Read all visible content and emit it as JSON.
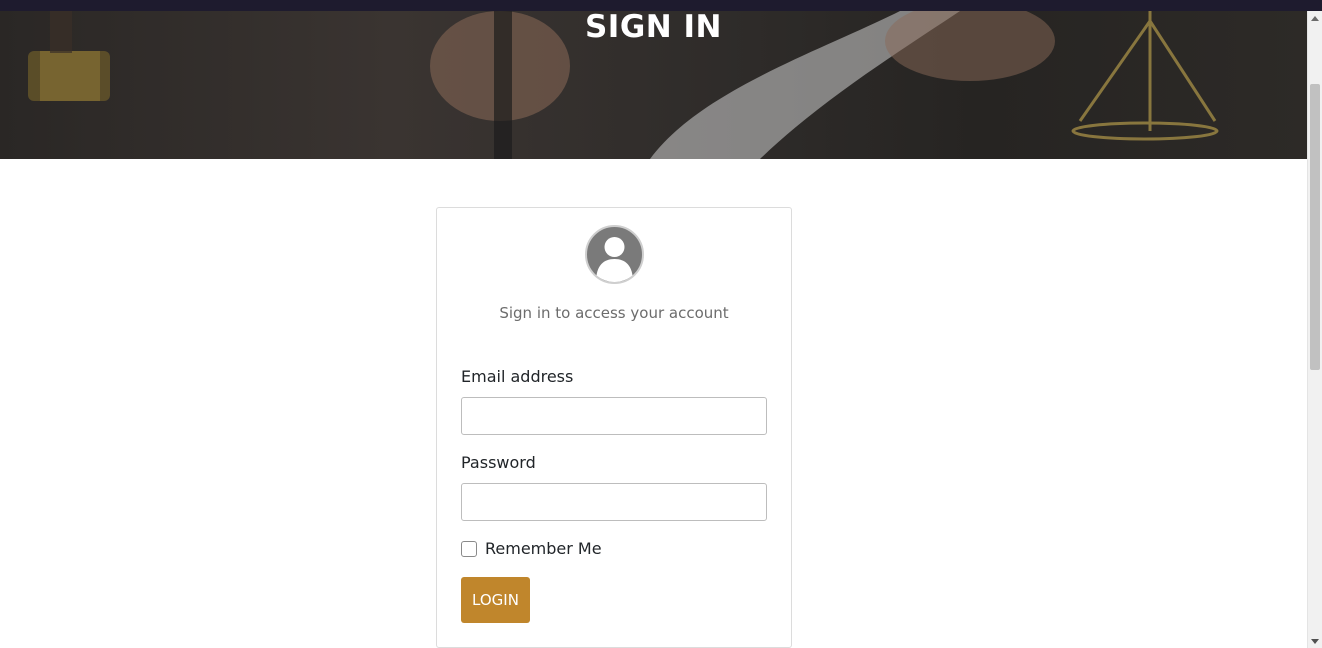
{
  "hero": {
    "title": "SIGN IN"
  },
  "login_card": {
    "avatar_icon": "user-silhouette-icon",
    "subtitle": "Sign in to access your account",
    "email_label": "Email address",
    "email_value": "",
    "password_label": "Password",
    "password_value": "",
    "remember_label": "Remember Me",
    "remember_checked": false,
    "login_button": "LOGIN"
  },
  "colors": {
    "accent": "#c0862c",
    "topbar": "#1e1b2e",
    "hero_overlay": "#2a2725"
  }
}
